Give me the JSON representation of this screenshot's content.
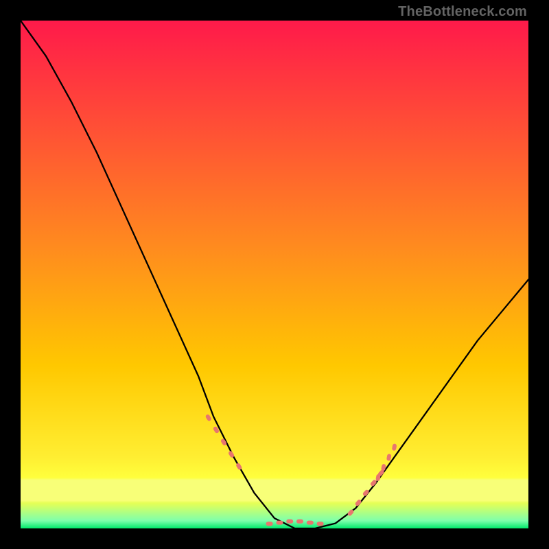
{
  "watermark": "TheBottleneck.com",
  "chart_data": {
    "type": "line",
    "title": "",
    "xlabel": "",
    "ylabel": "",
    "xlim": [
      0,
      100
    ],
    "ylim": [
      0,
      100
    ],
    "gradient_colors": {
      "top": "#ff1a4a",
      "mid": "#ffc800",
      "low": "#ffff3c",
      "band": "#f8ff78",
      "bottom": "#00e86b"
    },
    "curve": [
      {
        "x": 0,
        "y": 100
      },
      {
        "x": 5,
        "y": 93
      },
      {
        "x": 10,
        "y": 84
      },
      {
        "x": 15,
        "y": 74
      },
      {
        "x": 20,
        "y": 63
      },
      {
        "x": 25,
        "y": 52
      },
      {
        "x": 30,
        "y": 41
      },
      {
        "x": 35,
        "y": 30
      },
      {
        "x": 38,
        "y": 22
      },
      {
        "x": 42,
        "y": 14
      },
      {
        "x": 46,
        "y": 7
      },
      {
        "x": 50,
        "y": 2
      },
      {
        "x": 54,
        "y": 0
      },
      {
        "x": 58,
        "y": 0
      },
      {
        "x": 62,
        "y": 1
      },
      {
        "x": 66,
        "y": 4
      },
      {
        "x": 70,
        "y": 9
      },
      {
        "x": 75,
        "y": 16
      },
      {
        "x": 80,
        "y": 23
      },
      {
        "x": 85,
        "y": 30
      },
      {
        "x": 90,
        "y": 37
      },
      {
        "x": 95,
        "y": 43
      },
      {
        "x": 100,
        "y": 49
      }
    ],
    "marker_clusters": [
      {
        "cx": 40,
        "cy": 17,
        "n": 5,
        "spread": 3,
        "orient": "diag-down"
      },
      {
        "cx": 54,
        "cy": 1.5,
        "n": 6,
        "spread": 5,
        "orient": "horiz"
      },
      {
        "cx": 68,
        "cy": 7,
        "n": 5,
        "spread": 3,
        "orient": "diag-up"
      },
      {
        "cx": 72,
        "cy": 12,
        "n": 4,
        "spread": 2,
        "orient": "tick-up"
      }
    ],
    "marker_color": "#e8766e"
  }
}
